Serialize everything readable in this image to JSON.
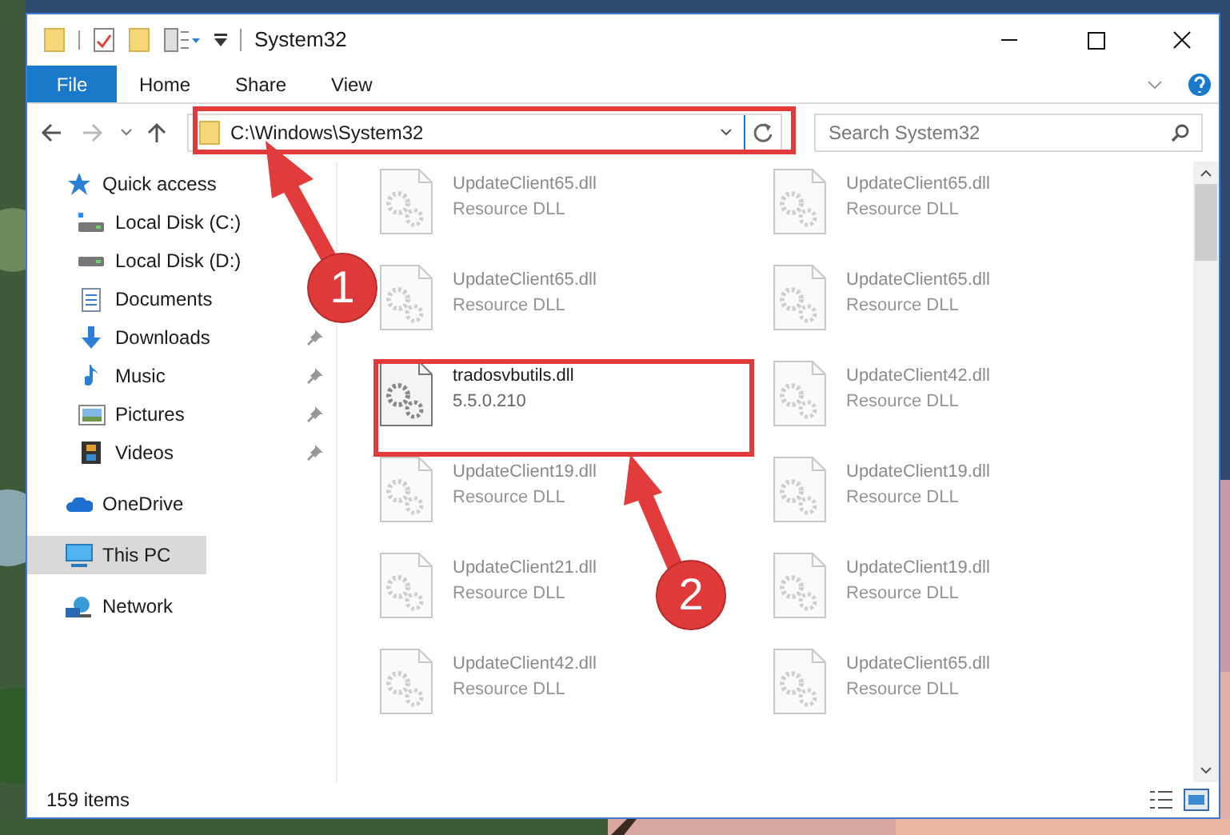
{
  "window": {
    "title": "System32"
  },
  "ribbon_tabs": [
    {
      "label": "File",
      "kind": "file"
    },
    {
      "label": "Home",
      "kind": "tab"
    },
    {
      "label": "Share",
      "kind": "tab"
    },
    {
      "label": "View",
      "kind": "tab"
    }
  ],
  "address_bar": {
    "path": "C:\\Windows\\System32"
  },
  "search": {
    "placeholder": "Search System32"
  },
  "nav": [
    {
      "label": "Quick access",
      "kind": "star",
      "selected": false,
      "children": [
        {
          "label": "Local Disk (C:)",
          "kind": "drive-c",
          "selected": false,
          "pinned": false
        },
        {
          "label": "Local Disk (D:)",
          "kind": "drive",
          "selected": false,
          "pinned": false
        },
        {
          "label": "Documents",
          "kind": "documents",
          "selected": false,
          "pinned": false
        },
        {
          "label": "Downloads",
          "kind": "downloads",
          "selected": false,
          "pinned": true
        },
        {
          "label": "Music",
          "kind": "music",
          "selected": false,
          "pinned": true
        },
        {
          "label": "Pictures",
          "kind": "pictures",
          "selected": false,
          "pinned": true
        },
        {
          "label": "Videos",
          "kind": "videos",
          "selected": false,
          "pinned": true
        }
      ]
    },
    {
      "label": "OneDrive",
      "kind": "cloud",
      "selected": false
    },
    {
      "label": "This PC",
      "kind": "pc",
      "selected": true
    },
    {
      "label": "Network",
      "kind": "network",
      "selected": false
    }
  ],
  "files": {
    "columns": [
      [
        {
          "name": "UpdateClient65.dll",
          "detail": "Resource DLL",
          "blurred": true
        },
        {
          "name": "UpdateClient65.dll",
          "detail": "Resource DLL",
          "blurred": true
        },
        {
          "name": "tradosvbutils.dll",
          "detail": "5.5.0.210",
          "blurred": false
        },
        {
          "name": "UpdateClient19.dll",
          "detail": "Resource DLL",
          "blurred": true
        },
        {
          "name": "UpdateClient21.dll",
          "detail": "Resource DLL",
          "blurred": true
        },
        {
          "name": "UpdateClient42.dll",
          "detail": "Resource DLL",
          "blurred": true
        }
      ],
      [
        {
          "name": "UpdateClient65.dll",
          "detail": "Resource DLL",
          "blurred": true
        },
        {
          "name": "UpdateClient65.dll",
          "detail": "Resource DLL",
          "blurred": true
        },
        {
          "name": "UpdateClient42.dll",
          "detail": "Resource DLL",
          "blurred": true
        },
        {
          "name": "UpdateClient19.dll",
          "detail": "Resource DLL",
          "blurred": true
        },
        {
          "name": "UpdateClient19.dll",
          "detail": "Resource DLL",
          "blurred": true
        },
        {
          "name": "UpdateClient65.dll",
          "detail": "Resource DLL",
          "blurred": true
        }
      ]
    ]
  },
  "status_bar": {
    "item_count": "159 items"
  },
  "annotations": [
    {
      "label": "1"
    },
    {
      "label": "2"
    }
  ]
}
